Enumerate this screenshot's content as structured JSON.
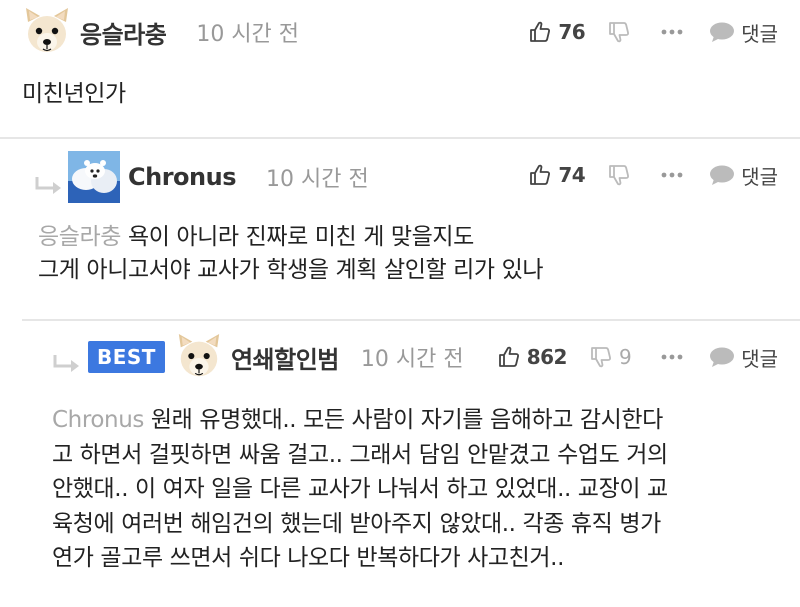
{
  "comments": [
    {
      "author": "응슬라충",
      "time": "10 시간 전",
      "likes": "76",
      "dislikes": "",
      "reply_label": "댓글",
      "lines": [
        "미친년인가"
      ]
    },
    {
      "author": "Chronus",
      "time": "10 시간 전",
      "likes": "74",
      "dislikes": "",
      "reply_label": "댓글",
      "mention": "응슬라충",
      "lines": [
        "욕이 아니라 진짜로 미친 게 맞을지도",
        "그게 아니고서야 교사가 학생을 계획 살인할 리가 있나"
      ]
    },
    {
      "badge": "BEST",
      "author": "연쇄할인범",
      "time": "10 시간 전",
      "likes": "862",
      "dislikes": "9",
      "reply_label": "댓글",
      "mention": "Chronus",
      "lines": [
        "원래 유명했대.. 모든 사람이 자기를 음해하고 감시한다",
        "고 하면서 걸핏하면 싸움 걸고.. 그래서 담임 안맡겼고 수업도 거의",
        "안했대.. 이 여자 일을 다른 교사가 나눠서 하고 있었대.. 교장이 교",
        "육청에 여러번 해임건의 했는데 받아주지 않았대.. 각종 휴직 병가",
        "연가 골고루 쓰면서 쉬다 나오다 반복하다가 사고친거.."
      ]
    }
  ],
  "icons": [
    "dog-avatar-icon",
    "polar-bear-avatar-icon",
    "thumbs-up-icon",
    "thumbs-down-icon",
    "more-icon",
    "speech-bubble-icon",
    "reply-arrow-icon"
  ],
  "colors": {
    "best_badge": "#3c78e0",
    "mention": "#a8a8a8",
    "time": "#999999"
  }
}
